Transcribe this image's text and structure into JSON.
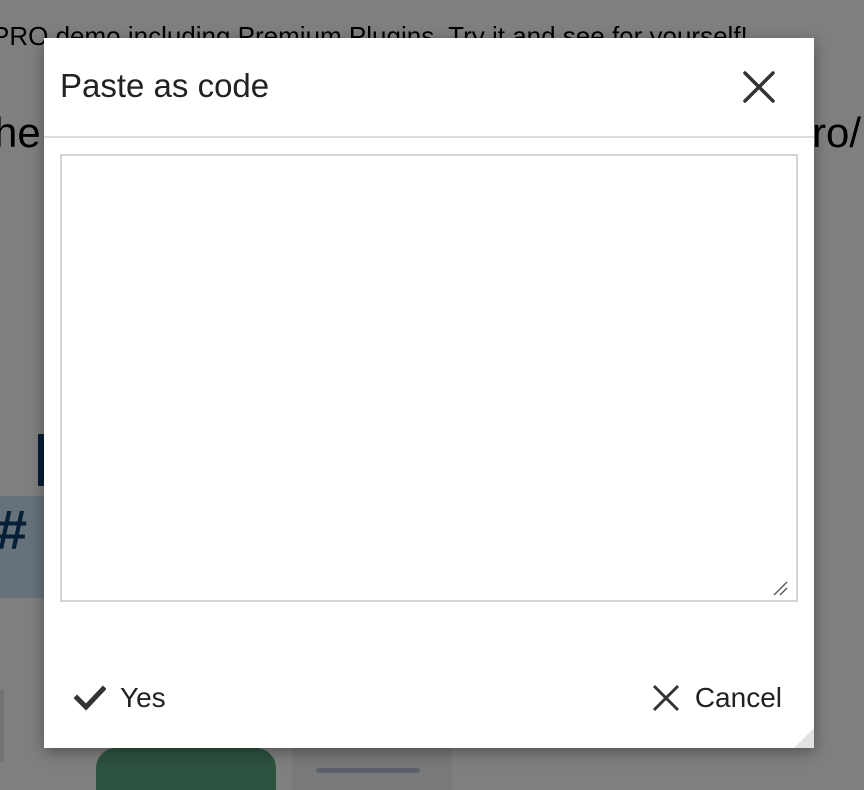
{
  "background": {
    "banner_text": "PRO demo including Premium Plugins. Try it and see for yourself!",
    "heading_left": "he",
    "heading_right": "ro/",
    "hash_glyph": "#"
  },
  "dialog": {
    "title": "Paste as code",
    "textarea": {
      "value": "",
      "placeholder": ""
    },
    "buttons": {
      "yes_label": "Yes",
      "cancel_label": "Cancel"
    }
  },
  "icons": {
    "close": "close-icon",
    "yes": "checkmark-icon",
    "cancel": "cancel-x-icon",
    "resize": "resize-grip-icon"
  },
  "colors": {
    "overlay": "rgba(0,0,0,0.5)",
    "dialog_bg": "#ffffff",
    "text": "#222222",
    "border": "#d4d4d4"
  }
}
